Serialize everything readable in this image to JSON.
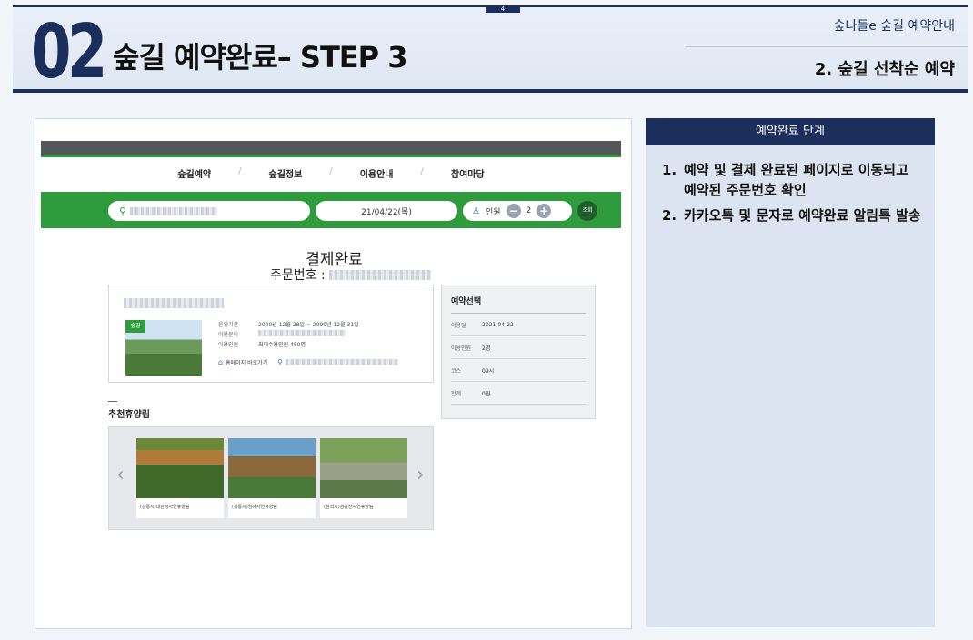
{
  "header": {
    "tab_marker": "4",
    "number": "02",
    "title": "숲길 예약완료– STEP 3",
    "crumb_top": "숲나들e 숲길 예약안내",
    "crumb_bottom": "2. 숲길 선착순 예약"
  },
  "screenshot": {
    "nav": [
      "숲길예약",
      "숲길정보",
      "이용안내",
      "참여마당"
    ],
    "search": {
      "date": "21/04/22(목)",
      "people_label": "인원",
      "people_count": "2",
      "search_button": "조회"
    },
    "done_title": "결제완료",
    "order_label": "주문번호 :",
    "card": {
      "thumb_tag": "숲길",
      "meta": [
        {
          "k": "운영기간",
          "v": "2020년 12월 28일 ~ 2099년 12월 31일"
        },
        {
          "k": "이용문의",
          "v": ""
        },
        {
          "k": "이용인원",
          "v": "최대수용인원 450명"
        }
      ],
      "homepage_link": "홈페이지 바로가기"
    },
    "side": {
      "title": "예약선택",
      "rows": [
        {
          "k": "이용일",
          "v": "2021-04-22"
        },
        {
          "k": "이용인원",
          "v": "2명"
        },
        {
          "k": "코스",
          "v": "09시"
        },
        {
          "k": "합계",
          "v": "0원"
        }
      ]
    },
    "recommend": {
      "title": "추천휴양림",
      "items": [
        {
          "label": "(강릉시)대관령자연휴양림"
        },
        {
          "label": "(강릉시)임해자연휴양림"
        },
        {
          "label": "(삼척시)검봉산자연휴양림"
        }
      ]
    }
  },
  "steps": {
    "title": "예약완료 단계",
    "items": [
      {
        "n": "1.",
        "text": "예약 및 결제 완료된 페이지로 이동되고 예약된 주문번호 확인"
      },
      {
        "n": "2.",
        "text": "카카오톡 및 문자로 예약완료 알림톡 발송"
      }
    ]
  },
  "colors": {
    "navy": "#1c2f5c",
    "green": "#2e9b3c",
    "panel": "#dce4f1"
  }
}
